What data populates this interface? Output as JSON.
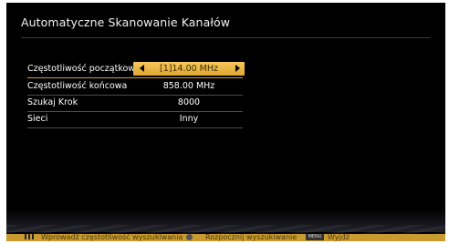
{
  "title": "Automatyczne Skanowanie Kanałów",
  "rows": [
    {
      "label": "Częstotliwość początkowa",
      "value": "[1]14.00 MHz"
    },
    {
      "label": "Częstotliwość końcowa",
      "value": "858.00 MHz"
    },
    {
      "label": "Szukaj Krok",
      "value": "8000"
    },
    {
      "label": "Sieci",
      "value": "Inny"
    }
  ],
  "footer": {
    "hint_enter": "Wprowadź częstotliwość wyszukiwania",
    "hint_ok": "Rozpocznij wyszukiwanie",
    "menu_icon_text": "MENU",
    "hint_menu": "Wyjdź"
  },
  "colors": {
    "highlight": "#e8b144",
    "background": "#000000",
    "footer": "#c99a2d"
  }
}
